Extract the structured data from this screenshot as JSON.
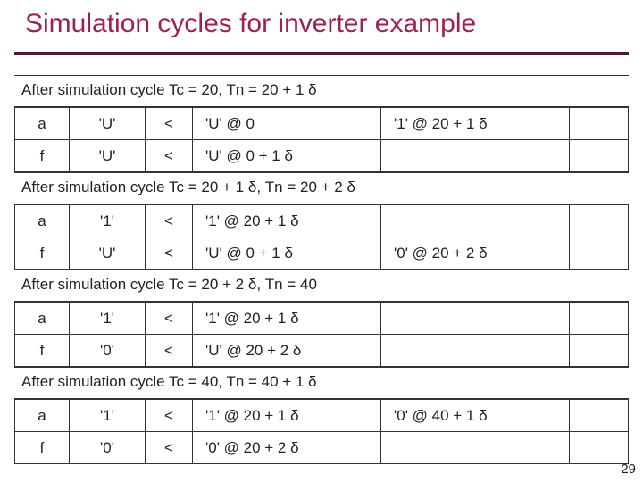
{
  "title": "Simulation cycles for inverter example",
  "pageNumber": "29",
  "sections": [
    {
      "header": "After simulation cycle Tc = 20, Tn = 20 + 1 δ",
      "rows": [
        {
          "name": "a",
          "val": "'U'",
          "cmp": "<",
          "ev1": "'U' @ 0",
          "ev2": "'1' @ 20 + 1 δ",
          "ev3": ""
        },
        {
          "name": "f",
          "val": "'U'",
          "cmp": "<",
          "ev1": "'U' @ 0 + 1 δ",
          "ev2": "",
          "ev3": ""
        }
      ]
    },
    {
      "header": "After simulation cycle Tc = 20 + 1 δ, Tn = 20 + 2 δ",
      "rows": [
        {
          "name": "a",
          "val": "'1'",
          "cmp": "<",
          "ev1": "'1' @ 20 + 1 δ",
          "ev2": "",
          "ev3": ""
        },
        {
          "name": "f",
          "val": "'U'",
          "cmp": "<",
          "ev1": "'U' @ 0 + 1 δ",
          "ev2": "'0' @ 20 + 2 δ",
          "ev3": ""
        }
      ]
    },
    {
      "header": "After simulation cycle Tc = 20 + 2 δ, Tn = 40",
      "rows": [
        {
          "name": "a",
          "val": "'1'",
          "cmp": "<",
          "ev1": "'1' @ 20 + 1 δ",
          "ev2": "",
          "ev3": ""
        },
        {
          "name": "f",
          "val": "'0'",
          "cmp": "<",
          "ev1": "'U' @ 20 + 2 δ",
          "ev2": "",
          "ev3": ""
        }
      ]
    },
    {
      "header": "After simulation cycle Tc = 40, Tn = 40 + 1 δ",
      "rows": [
        {
          "name": "a",
          "val": "'1'",
          "cmp": "<",
          "ev1": "'1' @ 20 + 1 δ",
          "ev2": "'0' @ 40 + 1 δ",
          "ev3": ""
        },
        {
          "name": "f",
          "val": "'0'",
          "cmp": "<",
          "ev1": "'0' @ 20 + 2 δ",
          "ev2": "",
          "ev3": ""
        }
      ]
    }
  ]
}
